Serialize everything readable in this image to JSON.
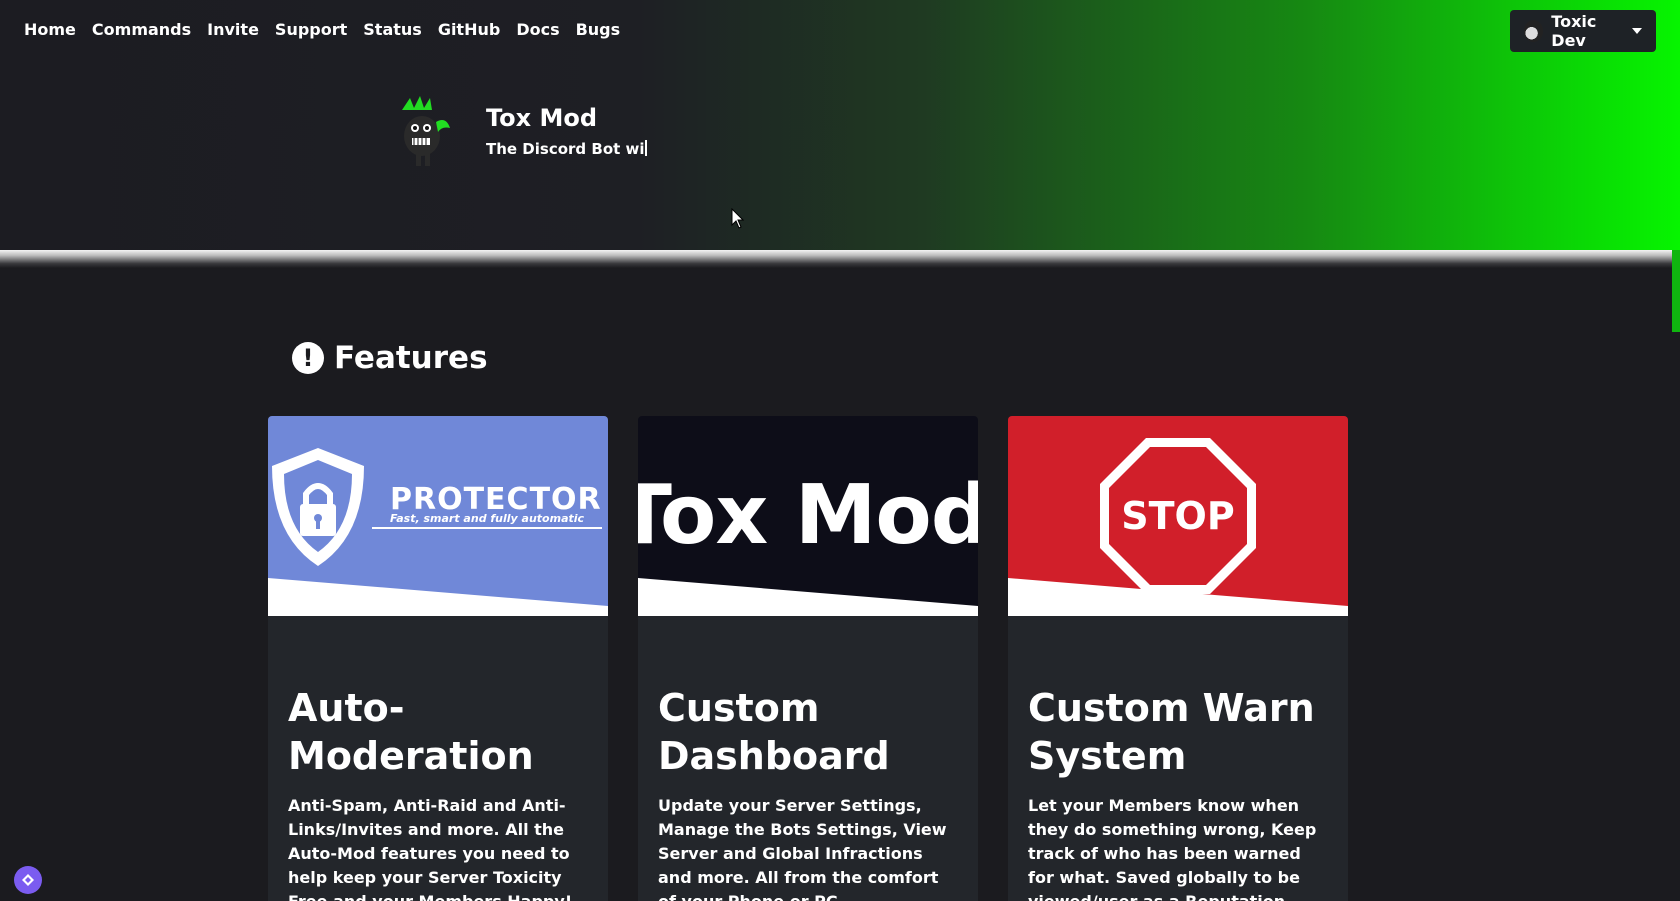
{
  "nav": {
    "items": [
      "Home",
      "Commands",
      "Invite",
      "Support",
      "Status",
      "GitHub",
      "Docs",
      "Bugs"
    ]
  },
  "user_menu": {
    "name": "Toxic Dev"
  },
  "hero": {
    "title": "Tox Mod",
    "tagline": "The Discord Bot wi"
  },
  "features": {
    "heading": "Features",
    "cards": [
      {
        "image_title": "PROTECTOR",
        "image_subtitle": "Fast, smart and fully automatic",
        "title": "Auto-Moderation",
        "text": "Anti-Spam, Anti-Raid and Anti-Links/Invites and more. All the Auto-Mod features you need to help keep your Server Toxicity Free and your Members Happy!"
      },
      {
        "image_title": "Tox Mod",
        "title": "Custom Dashboard",
        "text": "Update your Server Settings, Manage the Bots Settings, View Server and Global Infractions and more. All from the comfort of your Phone or PC."
      },
      {
        "image_title": "STOP",
        "title": "Custom Warn System",
        "text": "Let your Members know when they do something wrong, Keep track of who has been warned for what. Saved globally to be viewed/user as a Reputation System"
      }
    ]
  },
  "colors": {
    "brand_green": "#06f500",
    "protector_blue": "#7088d8",
    "stop_red": "#d11f2a",
    "fab_purple": "#7b5cf0"
  }
}
